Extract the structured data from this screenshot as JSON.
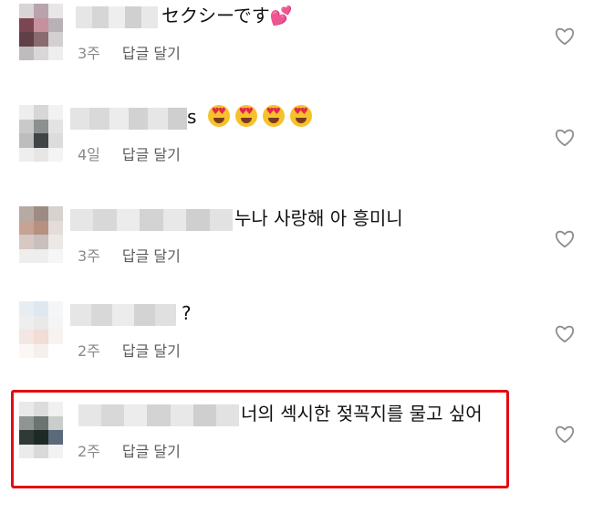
{
  "comments": [
    {
      "text": "セクシーです",
      "suffix": "💕",
      "time": "3주",
      "reply": "답글 달기"
    },
    {
      "text": "s",
      "time": "4일",
      "reply": "답글 달기"
    },
    {
      "text": "누나 사랑해 아 흥미니",
      "time": "3주",
      "reply": "답글 달기"
    },
    {
      "text": "?",
      "time": "2주",
      "reply": "답글 달기"
    },
    {
      "text": "너의 섹시한 젖꼭지를 물고 싶어",
      "time": "2주",
      "reply": "답글 달기"
    }
  ],
  "colors": {
    "highlight_border": "#e30b13",
    "meta_text": "#8a8a8a",
    "heart_outline": "#8e8e8e"
  },
  "icons": {
    "like": "heart-outline-icon",
    "emoji": "heart-eyes-emoji-icon"
  }
}
